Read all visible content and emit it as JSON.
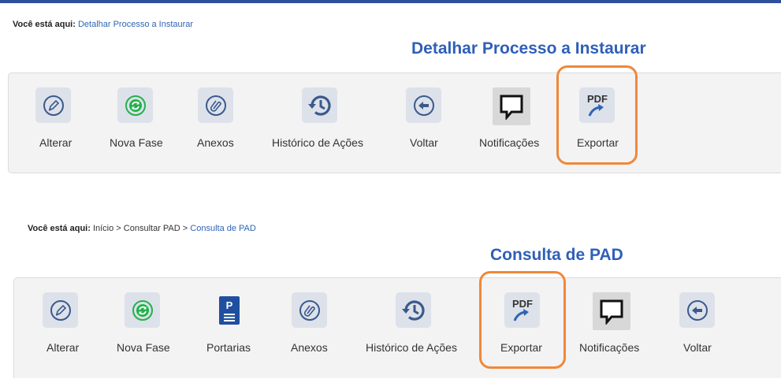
{
  "section1": {
    "breadcrumb": {
      "prefix": "Você está aqui:",
      "current": "Detalhar Processo a Instaurar"
    },
    "title": "Detalhar Processo a Instaurar",
    "tools": [
      {
        "label": "Alterar",
        "icon": "edit-pencil-icon"
      },
      {
        "label": "Nova Fase",
        "icon": "refresh-icon"
      },
      {
        "label": "Anexos",
        "icon": "paperclip-icon"
      },
      {
        "label": "Histórico de Ações",
        "icon": "history-icon"
      },
      {
        "label": "Voltar",
        "icon": "back-arrow-icon"
      },
      {
        "label": "Notificações",
        "icon": "speech-bubble-icon"
      },
      {
        "label": "Exportar",
        "icon": "pdf-export-icon"
      }
    ]
  },
  "section2": {
    "breadcrumb": {
      "prefix": "Você está aqui:",
      "path": "Início > Consultar PAD >",
      "current": "Consulta de PAD"
    },
    "title": "Consulta de PAD",
    "tools": [
      {
        "label": "Alterar",
        "icon": "edit-pencil-icon"
      },
      {
        "label": "Nova Fase",
        "icon": "refresh-icon"
      },
      {
        "label": "Portarias",
        "icon": "document-p-icon"
      },
      {
        "label": "Anexos",
        "icon": "paperclip-icon"
      },
      {
        "label": "Histórico de Ações",
        "icon": "history-icon"
      },
      {
        "label": "Exportar",
        "icon": "pdf-export-icon"
      },
      {
        "label": "Notificações",
        "icon": "speech-bubble-icon"
      },
      {
        "label": "Voltar",
        "icon": "back-arrow-icon"
      }
    ]
  },
  "icon_text": {
    "pdf": "PDF",
    "portaria": "P"
  },
  "colors": {
    "accent": "#2f5fb8",
    "highlight": "#f0883a",
    "icon_blue": "#3a5a8c",
    "refresh_green": "#22b24c"
  }
}
